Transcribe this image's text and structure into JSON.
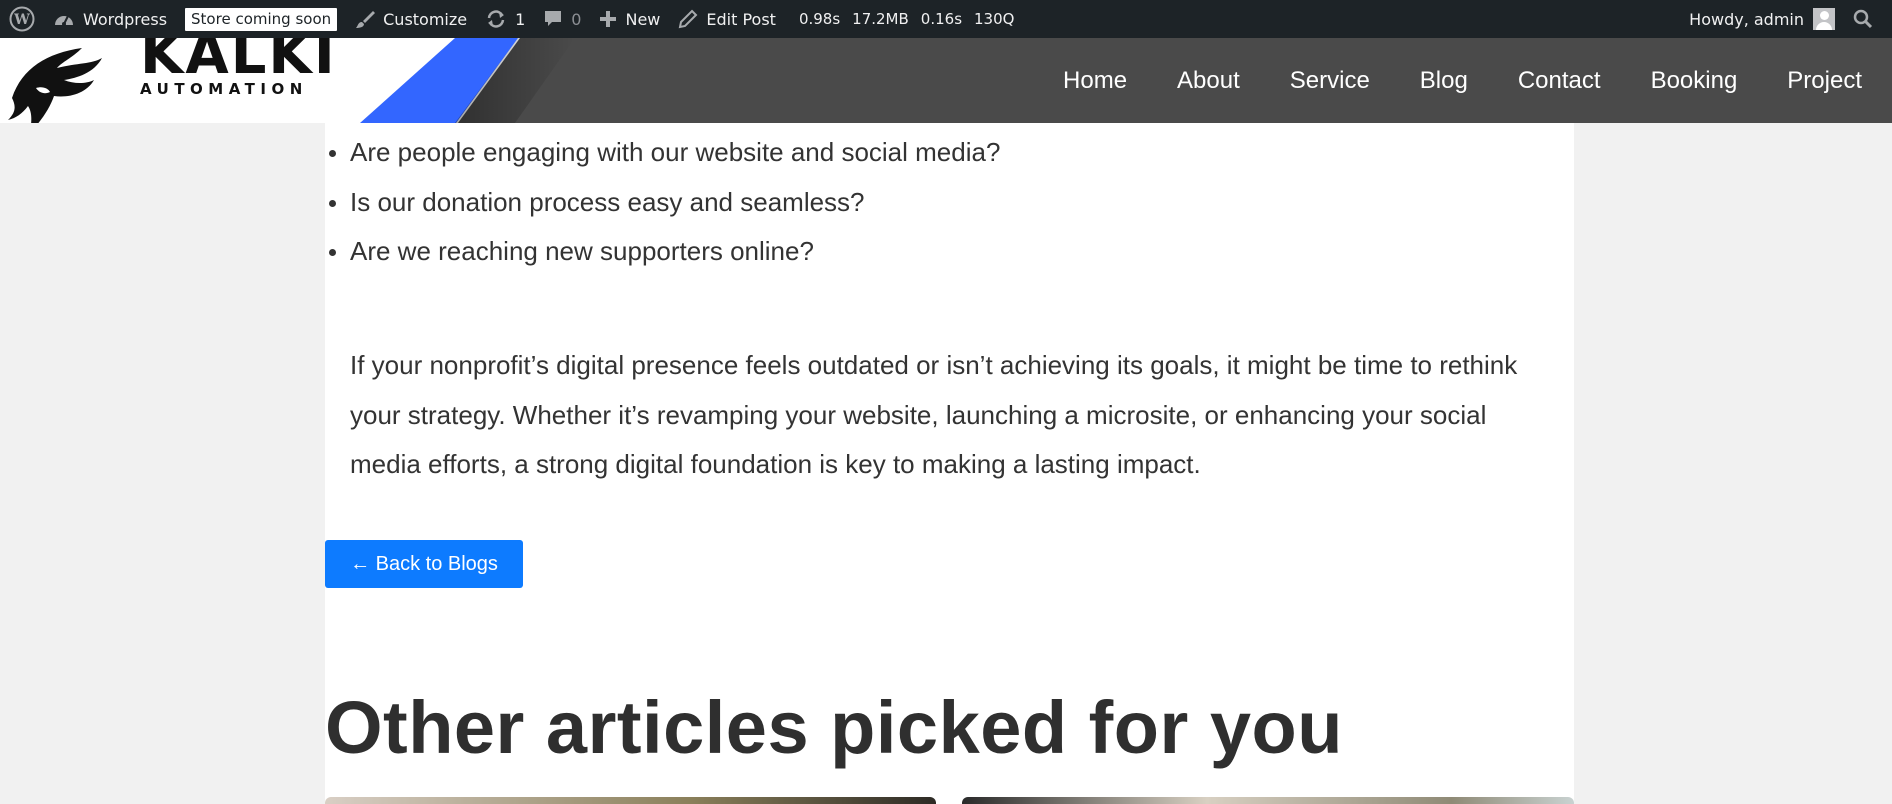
{
  "admin_bar": {
    "site_name": "Wordpress",
    "store_badge": "Store coming soon",
    "customize": "Customize",
    "updates_count": "1",
    "comments_count": "0",
    "new_label": "New",
    "edit_post": "Edit Post",
    "perf": [
      "0.98s",
      "17.2MB",
      "0.16s",
      "130Q"
    ],
    "greeting": "Howdy, admin"
  },
  "brand": {
    "name": "KALKI",
    "tagline": "AUTOMATION",
    "accent_color": "#3366ff"
  },
  "nav": {
    "items": [
      "Home",
      "About",
      "Service",
      "Blog",
      "Contact",
      "Booking",
      "Project"
    ]
  },
  "article": {
    "bullets": [
      "Are people engaging with our website and social media?",
      "Is our donation process easy and seamless?",
      "Are we reaching new supporters online?"
    ],
    "paragraph": "If your nonprofit’s digital presence feels outdated or isn’t achieving its goals, it might be time to rethink your strategy. Whether it’s revamping your website, launching a microsite, or enhancing your social media efforts, a strong digital foundation is key to making a lasting impact.",
    "back_button": "← Back to Blogs",
    "back_button_color": "#0d7bff"
  },
  "related": {
    "heading": "Other articles picked for you"
  },
  "icons": [
    "wordpress-icon",
    "dashboard-icon",
    "brush-icon",
    "updates-icon",
    "comment-icon",
    "plus-icon",
    "pencil-icon",
    "search-icon"
  ]
}
